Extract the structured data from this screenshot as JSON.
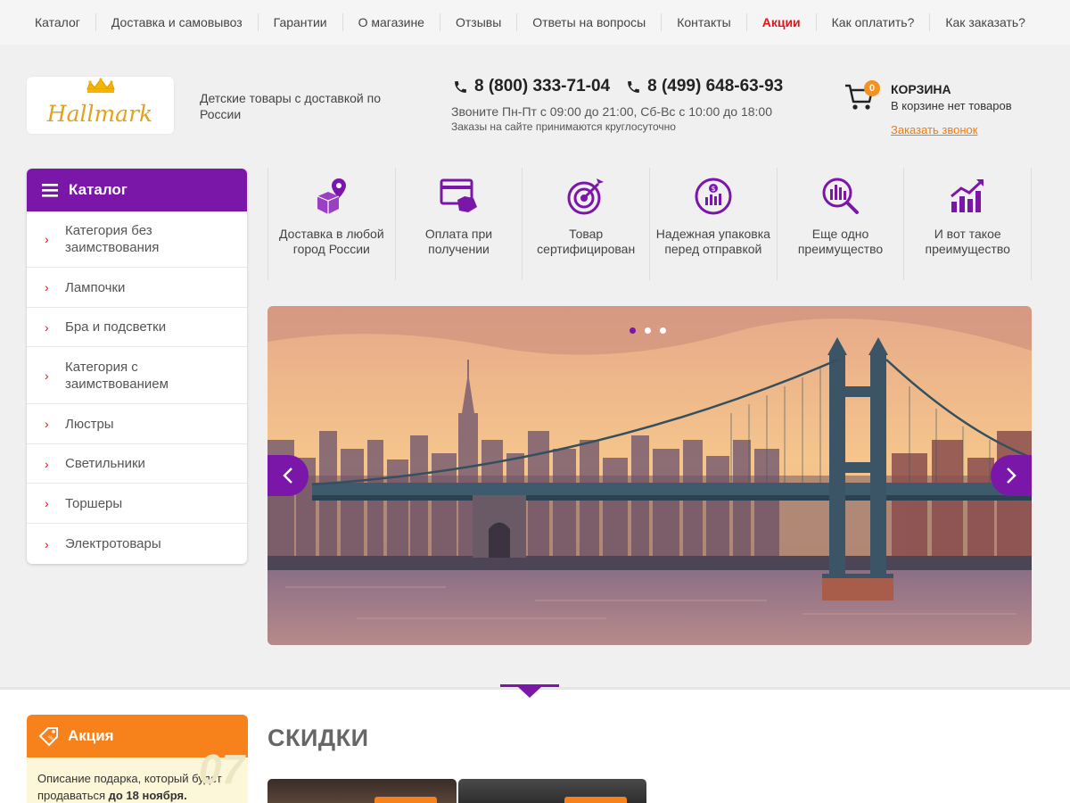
{
  "topnav": {
    "items": [
      "Каталог",
      "Доставка и самовывоз",
      "Гарантии",
      "О магазине",
      "Отзывы",
      "Ответы на вопросы",
      "Контакты",
      "Акции",
      "Как оплатить?",
      "Как заказать?"
    ],
    "highlight_color": "#e0161d"
  },
  "header": {
    "logo_text": "Hallmark",
    "tagline": "Детские товары с доставкой по России",
    "phone1": "8 (800) 333-71-04",
    "phone2": "8 (499) 648-63-93",
    "hours": "Звоните Пн-Пт с 09:00 до 21:00, Сб-Вс с 10:00 до 18:00",
    "hours_note": "Заказы на сайте принимаются круглосуточно",
    "cart": {
      "count": "0",
      "title": "КОРЗИНА",
      "status": "В корзине нет товаров"
    },
    "callback": "Заказать звонок"
  },
  "catalog": {
    "title": "Каталог",
    "items": [
      "Категория без заимствования",
      "Лампочки",
      "Бра и подсветки",
      "Категория с заимствованием",
      "Люстры",
      "Светильники",
      "Торшеры",
      "Электротовары"
    ]
  },
  "advantages": [
    {
      "icon": "delivery-location-icon",
      "label": "Доставка в любой город России"
    },
    {
      "icon": "payment-on-delivery-icon",
      "label": "Оплата при получении"
    },
    {
      "icon": "certified-target-icon",
      "label": "Товар сертифицирован"
    },
    {
      "icon": "secure-packaging-icon",
      "label": "Надежная упаковка перед отправкой"
    },
    {
      "icon": "search-analytics-icon",
      "label": "Еще одно преимущество"
    },
    {
      "icon": "growth-chart-icon",
      "label": "И вот такое преимущество"
    }
  ],
  "slider": {
    "slides": 3,
    "active": 0
  },
  "promo": {
    "title": "Акция",
    "text_before": "Описание подарка, который будет продаваться ",
    "text_bold": "до 18 ноября.",
    "watermark": "07"
  },
  "discounts": {
    "title": "СКИДКИ"
  },
  "colors": {
    "accent": "#7b17a8",
    "orange": "#f7821b",
    "red": "#e0161d"
  }
}
